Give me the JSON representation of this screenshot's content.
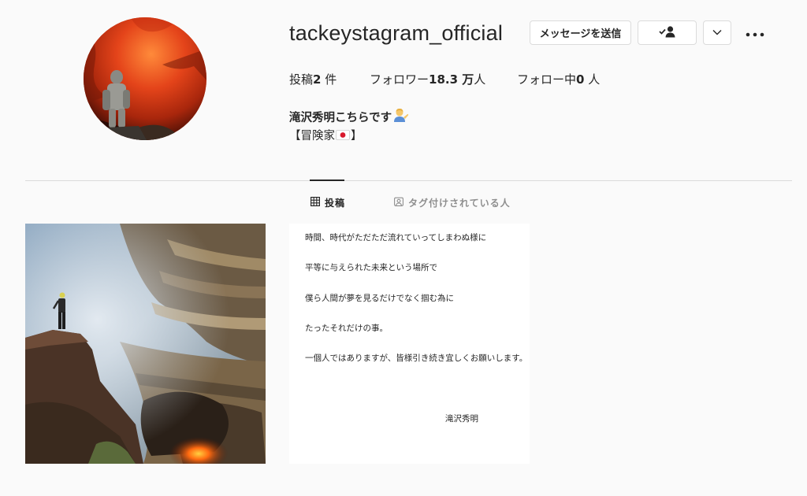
{
  "profile": {
    "username": "tackeystagram_official",
    "avatar_icon": "explorer-in-volcano-photo"
  },
  "actions": {
    "message_label": "メッセージを送信",
    "follow_icon": "person-check-icon",
    "dropdown_icon": "chevron-down-icon",
    "more_icon": "more-horizontal-icon"
  },
  "stats": {
    "posts_prefix": "投稿",
    "posts_count": "2",
    "posts_suffix": " 件",
    "followers_prefix": "フォロワー",
    "followers_count": "18.3 万",
    "followers_suffix": "人",
    "following_prefix": "フォロー中",
    "following_count": "0",
    "following_suffix": " 人"
  },
  "bio": {
    "name": "滝沢秀明こちらです",
    "name_emoji": "man-tipping-hand-emoji",
    "line_open": "【冒険家",
    "line_flag": "japan-flag-emoji",
    "line_close": "】"
  },
  "tabs": [
    {
      "label": "投稿",
      "icon": "grid-icon",
      "active": true
    },
    {
      "label": "タグ付けされている人",
      "icon": "tagged-icon",
      "active": false
    }
  ],
  "posts": {
    "post1": {
      "icon": "volcano-crater-photo"
    },
    "post2": {
      "lines": [
        "時間、時代がただただ流れていってしまわぬ様に",
        "平等に与えられた未来という場所で",
        "僕ら人間が夢を見るだけでなく掴む為に",
        "たったそれだけの事。",
        "一個人ではありますが、皆様引き続き宜しくお願いします。"
      ],
      "signature": "滝沢秀明"
    }
  }
}
